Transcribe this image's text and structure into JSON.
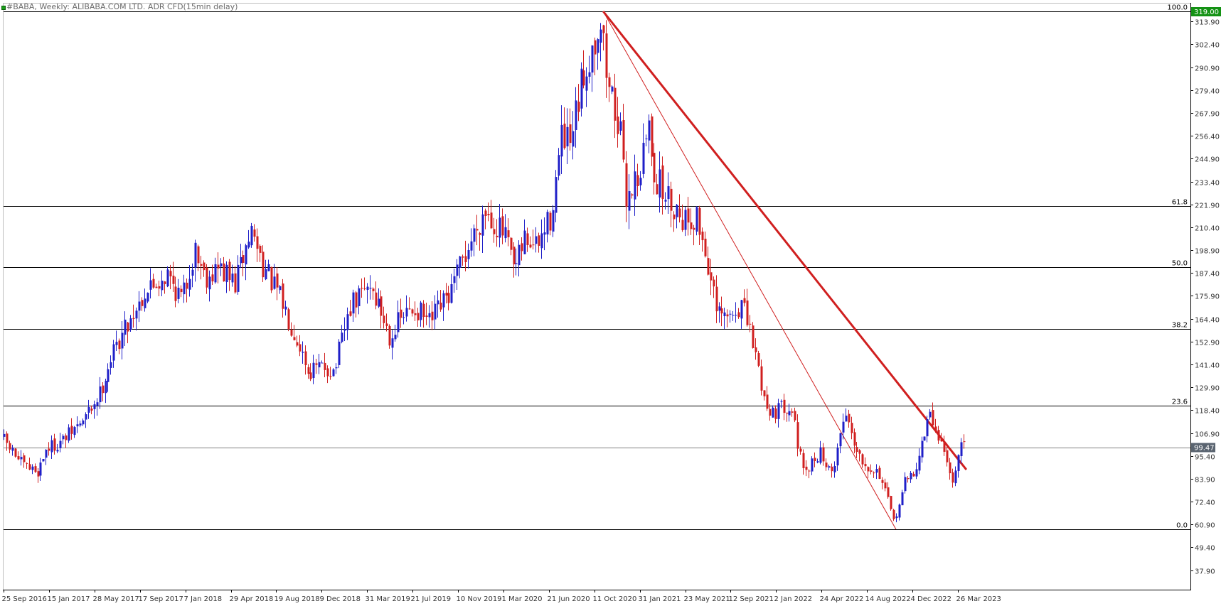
{
  "symbol_title": "#BABA, Weekly:  ALIBABA.COM LTD. ADR CFD(15min delay)",
  "colors": {
    "bull": "#1f1fc8",
    "bear": "#d01f1f",
    "trendline": "#d01f1f",
    "fib_line": "#000000",
    "current_price_box": "#5a6470",
    "top_price_box": "#149214",
    "axis_text": "#333333"
  },
  "chart_data": {
    "type": "candlestick",
    "title": "#BABA, Weekly:  ALIBABA.COM LTD. ADR CFD(15min delay)",
    "y_ticks": [
      313.9,
      302.4,
      290.9,
      279.4,
      267.9,
      256.4,
      244.9,
      233.4,
      221.9,
      210.4,
      198.9,
      187.4,
      175.9,
      164.4,
      152.9,
      141.4,
      129.9,
      118.4,
      106.9,
      95.4,
      83.9,
      72.4,
      60.9,
      49.4,
      37.9
    ],
    "x_tick_labels": [
      "25 Sep 2016",
      "15 Jan 2017",
      "28 May 2017",
      "17 Sep 2017",
      "7 Jan 2018",
      "29 Apr 2018",
      "19 Aug 2018",
      "9 Dec 2018",
      "31 Mar 2019",
      "21 Jul 2019",
      "10 Nov 2019",
      "1 Mar 2020",
      "21 Jun 2020",
      "11 Oct 2020",
      "31 Jan 2021",
      "23 May 2021",
      "12 Sep 2021",
      "2 Jan 2022",
      "24 Apr 2022",
      "14 Aug 2022",
      "4 Dec 2022",
      "26 Mar 2023"
    ],
    "ylim": [
      30,
      320
    ],
    "fib_levels": [
      {
        "label": "100.0",
        "price": 319.0
      },
      {
        "label": "61.8",
        "price": 221.2
      },
      {
        "label": "50.0",
        "price": 190.2
      },
      {
        "label": "38.2",
        "price": 159.2
      },
      {
        "label": "23.6",
        "price": 120.8
      },
      {
        "label": "0.0",
        "price": 58.5
      }
    ],
    "current_price": "99.47",
    "top_price": "319.00",
    "trendlines": [
      {
        "from": {
          "date": "2020-10-25",
          "price": 319.0
        },
        "to": {
          "date": "2023-04-16",
          "price": 88.5
        },
        "width": 3
      },
      {
        "from": {
          "date": "2020-10-25",
          "price": 319.0
        },
        "to": {
          "date": "2022-10-23",
          "price": 58.5
        },
        "width": 1
      }
    ],
    "path_points": [
      {
        "date": "2016-09-25",
        "price": 105.0
      },
      {
        "date": "2016-11-20",
        "price": 90.0
      },
      {
        "date": "2016-12-25",
        "price": 87.5
      },
      {
        "date": "2017-01-15",
        "price": 99.0
      },
      {
        "date": "2017-02-25",
        "price": 103.0
      },
      {
        "date": "2017-04-20",
        "price": 114.0
      },
      {
        "date": "2017-05-28",
        "price": 127.0
      },
      {
        "date": "2017-06-20",
        "price": 142.0
      },
      {
        "date": "2017-07-20",
        "price": 156.0
      },
      {
        "date": "2017-09-17",
        "price": 178.0
      },
      {
        "date": "2017-11-10",
        "price": 187.0
      },
      {
        "date": "2017-12-20",
        "price": 174.0
      },
      {
        "date": "2018-01-20",
        "price": 200.0
      },
      {
        "date": "2018-02-15",
        "price": 186.0
      },
      {
        "date": "2018-03-20",
        "price": 190.0
      },
      {
        "date": "2018-04-29",
        "price": 182.0
      },
      {
        "date": "2018-06-10",
        "price": 209.0
      },
      {
        "date": "2018-07-15",
        "price": 188.0
      },
      {
        "date": "2018-08-19",
        "price": 175.0
      },
      {
        "date": "2018-10-10",
        "price": 150.0
      },
      {
        "date": "2018-10-28",
        "price": 138.0
      },
      {
        "date": "2018-12-09",
        "price": 140.0
      },
      {
        "date": "2019-01-01",
        "price": 138.0
      },
      {
        "date": "2019-02-10",
        "price": 170.0
      },
      {
        "date": "2019-03-31",
        "price": 182.0
      },
      {
        "date": "2019-05-20",
        "price": 156.0
      },
      {
        "date": "2019-06-15",
        "price": 164.0
      },
      {
        "date": "2019-07-21",
        "price": 170.0
      },
      {
        "date": "2019-08-25",
        "price": 162.0
      },
      {
        "date": "2019-10-20",
        "price": 178.0
      },
      {
        "date": "2019-11-10",
        "price": 190.0
      },
      {
        "date": "2020-01-10",
        "price": 220.0
      },
      {
        "date": "2020-03-01",
        "price": 205.0
      },
      {
        "date": "2020-03-25",
        "price": 187.0
      },
      {
        "date": "2020-04-20",
        "price": 205.0
      },
      {
        "date": "2020-05-20",
        "price": 200.0
      },
      {
        "date": "2020-06-21",
        "price": 215.0
      },
      {
        "date": "2020-07-20",
        "price": 255.0
      },
      {
        "date": "2020-08-10",
        "price": 250.0
      },
      {
        "date": "2020-09-10",
        "price": 285.0
      },
      {
        "date": "2020-10-25",
        "price": 315.0
      },
      {
        "date": "2020-11-10",
        "price": 285.0
      },
      {
        "date": "2020-12-10",
        "price": 262.0
      },
      {
        "date": "2020-12-25",
        "price": 225.0
      },
      {
        "date": "2021-01-31",
        "price": 240.0
      },
      {
        "date": "2021-02-20",
        "price": 262.0
      },
      {
        "date": "2021-03-10",
        "price": 235.0
      },
      {
        "date": "2021-04-10",
        "price": 225.0
      },
      {
        "date": "2021-05-23",
        "price": 215.0
      },
      {
        "date": "2021-06-20",
        "price": 215.0
      },
      {
        "date": "2021-07-10",
        "price": 200.0
      },
      {
        "date": "2021-08-10",
        "price": 165.0
      },
      {
        "date": "2021-09-12",
        "price": 165.0
      },
      {
        "date": "2021-10-10",
        "price": 172.0
      },
      {
        "date": "2021-11-10",
        "price": 150.0
      },
      {
        "date": "2021-12-10",
        "price": 120.0
      },
      {
        "date": "2022-01-02",
        "price": 118.0
      },
      {
        "date": "2022-02-10",
        "price": 122.0
      },
      {
        "date": "2022-03-14",
        "price": 85.0
      },
      {
        "date": "2022-04-24",
        "price": 98.0
      },
      {
        "date": "2022-05-20",
        "price": 85.0
      },
      {
        "date": "2022-06-25",
        "price": 118.0
      },
      {
        "date": "2022-07-25",
        "price": 98.0
      },
      {
        "date": "2022-08-14",
        "price": 92.0
      },
      {
        "date": "2022-09-20",
        "price": 86.0
      },
      {
        "date": "2022-10-23",
        "price": 62.0
      },
      {
        "date": "2022-11-20",
        "price": 82.0
      },
      {
        "date": "2022-12-15",
        "price": 88.0
      },
      {
        "date": "2023-01-20",
        "price": 116.0
      },
      {
        "date": "2023-02-20",
        "price": 102.0
      },
      {
        "date": "2023-03-15",
        "price": 84.0
      },
      {
        "date": "2023-03-26",
        "price": 86.0
      },
      {
        "date": "2023-04-09",
        "price": 99.5
      }
    ]
  }
}
